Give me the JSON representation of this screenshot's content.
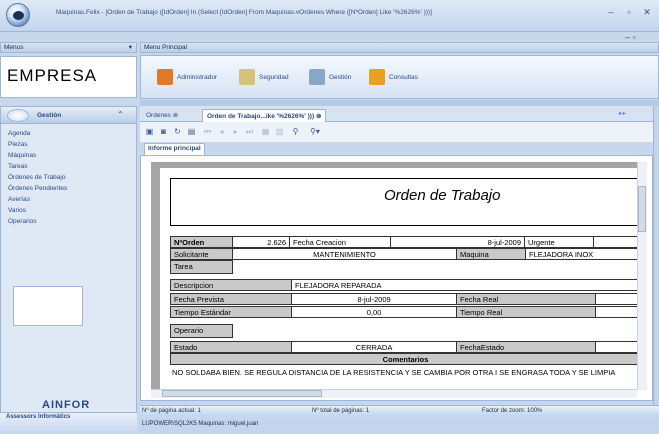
{
  "window": {
    "title": "Maquinas.Felix - [Orden de Trabajo ([IdOrden] In (Select [IdOrden] From Maquinas.vOrdenes Where ([NºOrden] Like '%2626%' )))]"
  },
  "left_panel": {
    "header": "Menus",
    "empresa": "EMPRESA",
    "group": "Gestión",
    "items": [
      "Agenda",
      "Piezas",
      "Máquinas",
      "Tareas",
      "Órdenes de Trabajo",
      "Órdenes Pendientes",
      "Averías",
      "Varios",
      "Operarios"
    ],
    "brand": "AINFOR",
    "brand_sub": "Assessors Informàtics"
  },
  "ribbon": {
    "header": "Menu Principal",
    "items": [
      {
        "label": "Administrador",
        "icon": "admin-icon",
        "color": "#e07a28"
      },
      {
        "label": "Seguridad",
        "icon": "security-icon",
        "color": "#d6c27a"
      },
      {
        "label": "Gestión",
        "icon": "gestion-icon",
        "color": "#8aa6c6"
      },
      {
        "label": "Consultas",
        "icon": "consultas-icon",
        "color": "#e8a020"
      }
    ]
  },
  "tabs": [
    {
      "label": "Ordenes"
    },
    {
      "label": "Orden de Trabajo...ike '%2626%' )))"
    }
  ],
  "report_tab": "Informe principal",
  "report": {
    "title": "Orden de Trabajo",
    "norden_label": "NºOrden",
    "norden": "2.626",
    "fecha_creacion_label": "Fecha Creacion",
    "fecha_creacion": "8-jul-2009",
    "urgente_label": "Urgente",
    "solicitante_label": "Solicitante",
    "solicitante": "MANTENIMIENTO",
    "maquina_label": "Maquina",
    "maquina": "FLEJADORA INOX",
    "tarea_label": "Tarea",
    "descripcion_label": "Descripcion",
    "descripcion": "FLEJADORA REPARADA",
    "fecha_prevista_label": "Fecha Prevista",
    "fecha_prevista": "8-jul-2009",
    "fecha_real_label": "Fecha Real",
    "tiempo_estandar_label": "Tiempo Estándar",
    "tiempo_estandar": "0,00",
    "tiempo_real_label": "Tiempo Real",
    "operario_label": "Operario",
    "estado_label": "Estado",
    "estado": "CERRADA",
    "fecha_estado_label": "FechaEstado",
    "comentarios_label": "Comentarios",
    "comentarios": "NO SOLDABA BIEN. SE REGULA DISTANCIA DE LA RESISTENCIA Y SE CAMBIA POR OTRA I SE ENGRASA TODA Y SE LIMPIA"
  },
  "status": {
    "pagina_actual": "Nº de página actual: 1",
    "total_paginas": "Nº total de páginas: 1",
    "zoom": "Factor de zoom: 100%",
    "connection": "LUPOWER\\SQL2K5 Maquinas: miguel.juan"
  }
}
